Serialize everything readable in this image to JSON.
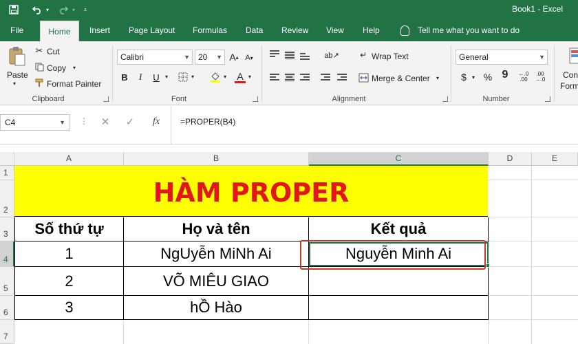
{
  "window": {
    "title": "Book1  -  Excel"
  },
  "tabs": [
    "File",
    "Home",
    "Insert",
    "Page Layout",
    "Formulas",
    "Data",
    "Review",
    "View",
    "Help"
  ],
  "tell_me": "Tell me what you want to do",
  "clipboard": {
    "paste": "Paste",
    "cut": "Cut",
    "copy": "Copy",
    "format_painter": "Format Painter",
    "label": "Clipboard"
  },
  "font": {
    "name": "Calibri",
    "size": "20",
    "label": "Font",
    "grow": "A",
    "shrink": "A",
    "bold": "B",
    "italic": "I",
    "underline": "U"
  },
  "alignment": {
    "wrap_text": "Wrap Text",
    "merge_center": "Merge & Center",
    "label": "Alignment"
  },
  "number": {
    "format": "General",
    "currency": "$",
    "percent": "%",
    "comma": "9",
    "label": "Number"
  },
  "styles_partial": {
    "line1": "Con",
    "line2": "Form"
  },
  "formula_bar": {
    "name_box": "C4",
    "fx": "fx",
    "formula": "=PROPER(B4)"
  },
  "columns": [
    "A",
    "B",
    "C",
    "D",
    "E"
  ],
  "rows": [
    "1",
    "2",
    "3",
    "4",
    "5",
    "6",
    "7"
  ],
  "sheet": {
    "banner": "HÀM PROPER",
    "headers": [
      "Số thứ tự",
      "Họ và tên",
      "Kết quả"
    ],
    "data": [
      [
        "1",
        "NgUyễn MiNh Ai",
        "Nguyễn Minh Ai"
      ],
      [
        "2",
        "VÕ MIÊU GIAO",
        ""
      ],
      [
        "3",
        "hỒ Hào",
        ""
      ]
    ]
  },
  "colors": {
    "excel_green": "#217346",
    "banner_fill": "#ffff00",
    "banner_text": "#e01818",
    "highlight": "#c0392b"
  }
}
